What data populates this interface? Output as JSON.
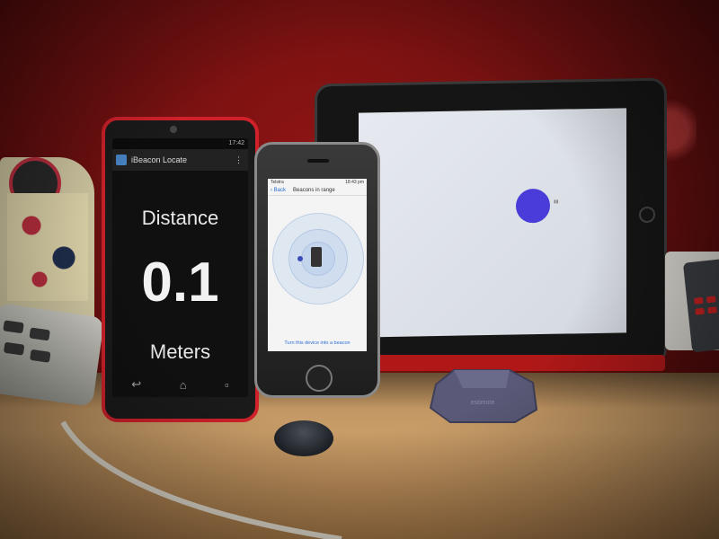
{
  "android_app": {
    "status_time": "17:42",
    "app_title": "iBeacon Locate",
    "distance_label": "Distance",
    "distance_value": "0.1",
    "distance_unit": "Meters"
  },
  "iphone_app": {
    "carrier": "Telstra",
    "time": "18:43 pm",
    "back_label": "Back",
    "nav_title": "Beacons in range",
    "action_text": "Turn this device into a beacon"
  },
  "beacon_label": "estimote"
}
